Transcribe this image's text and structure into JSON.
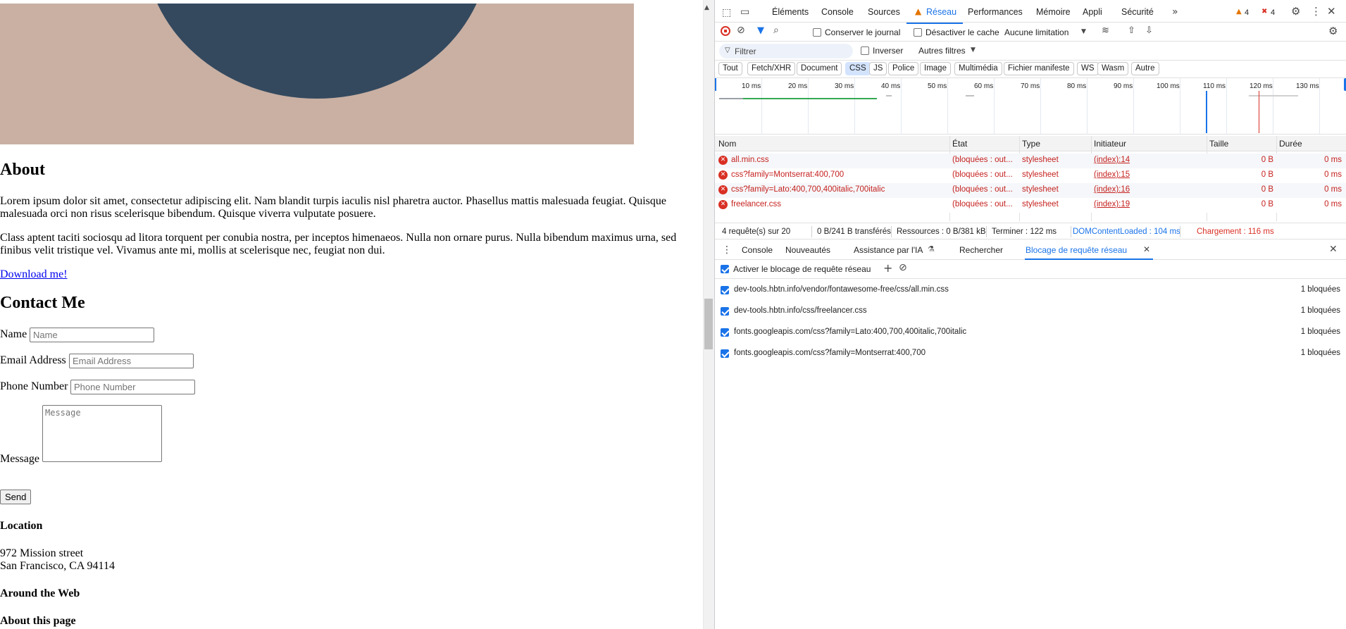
{
  "page": {
    "about_title": "About",
    "about_p1": "Lorem ipsum dolor sit amet, consectetur adipiscing elit. Nam blandit turpis iaculis nisl pharetra auctor. Phasellus mattis malesuada feugiat. Quisque malesuada orci non risus scelerisque bibendum. Quisque viverra vulputate posuere.",
    "about_p2": "Class aptent taciti sociosqu ad litora torquent per conubia nostra, per inceptos himenaeos. Nulla non ornare purus. Nulla bibendum maximus urna, sed finibus velit tristique vel. Vivamus ante mi, mollis at scelerisque nec, feugiat non dui.",
    "download_link": "Download me!",
    "contact_title": "Contact Me",
    "name_label": "Name",
    "name_placeholder": "Name",
    "email_label": "Email Address",
    "email_placeholder": "Email Address",
    "phone_label": "Phone Number",
    "phone_placeholder": "Phone Number",
    "message_label": "Message",
    "message_placeholder": "Message",
    "send_button": "Send",
    "location_title": "Location",
    "address_line1": "972 Mission street",
    "address_line2": "San Francisco, CA 94114",
    "around_web_title": "Around the Web",
    "about_page_title": "About this page",
    "colors": {
      "hero_bg": "#c9b0a3",
      "hero_circle": "#34495e",
      "hero_band": "#d9a741",
      "link": "#0000ee"
    }
  },
  "devtools": {
    "tabs": [
      "Éléments",
      "Console",
      "Sources",
      "Réseau",
      "Performances",
      "Mémoire",
      "Appli",
      "Sécurité"
    ],
    "active_tab": "Réseau",
    "more_tabs_icon": "chevron-double-right-icon",
    "warnings_count": "4",
    "errors_count": "4",
    "toolbar": {
      "preserve_log": "Conserver le journal",
      "disable_cache": "Désactiver le cache",
      "throttling": "Aucune limitation"
    },
    "filter": {
      "placeholder": "Filtrer",
      "invert": "Inverser",
      "more_filters": "Autres filtres"
    },
    "type_filters": [
      "Tout",
      "Fetch/XHR",
      "Document",
      "CSS",
      "JS",
      "Police",
      "Image",
      "Multimédia",
      "Fichier manifeste",
      "WS",
      "Wasm",
      "Autre"
    ],
    "active_type_filter": "CSS",
    "timeline_ticks": [
      "10 ms",
      "20 ms",
      "30 ms",
      "40 ms",
      "50 ms",
      "60 ms",
      "70 ms",
      "80 ms",
      "90 ms",
      "100 ms",
      "110 ms",
      "120 ms",
      "130 ms"
    ],
    "table": {
      "headers": [
        "Nom",
        "État",
        "Type",
        "Initiateur",
        "Taille",
        "Durée"
      ],
      "rows": [
        {
          "name": "all.min.css",
          "status": "(bloquées : out...",
          "type": "stylesheet",
          "initiator": "(index):14",
          "size": "0 B",
          "time": "0 ms"
        },
        {
          "name": "css?family=Montserrat:400,700",
          "status": "(bloquées : out...",
          "type": "stylesheet",
          "initiator": "(index):15",
          "size": "0 B",
          "time": "0 ms"
        },
        {
          "name": "css?family=Lato:400,700,400italic,700italic",
          "status": "(bloquées : out...",
          "type": "stylesheet",
          "initiator": "(index):16",
          "size": "0 B",
          "time": "0 ms"
        },
        {
          "name": "freelancer.css",
          "status": "(bloquées : out...",
          "type": "stylesheet",
          "initiator": "(index):19",
          "size": "0 B",
          "time": "0 ms"
        }
      ]
    },
    "summary": {
      "requests": "4 requête(s) sur 20",
      "transferred": "0 B/241 B transférés",
      "resources": "Ressources : 0 B/381 kB",
      "finish": "Terminer : 122 ms",
      "dcl": "DOMContentLoaded : 104 ms",
      "load": "Chargement : 116 ms"
    },
    "drawer": {
      "tabs": [
        "Console",
        "Nouveautés",
        "Assistance par l'IA",
        "Rechercher",
        "Blocage de requête réseau"
      ],
      "active_tab": "Blocage de requête réseau",
      "enable_blocking": "Activer le blocage de requête réseau",
      "patterns": [
        {
          "url": "dev-tools.hbtn.info/vendor/fontawesome-free/css/all.min.css",
          "count": "1 bloquées"
        },
        {
          "url": "dev-tools.hbtn.info/css/freelancer.css",
          "count": "1 bloquées"
        },
        {
          "url": "fonts.googleapis.com/css?family=Lato:400,700,400italic,700italic",
          "count": "1 bloquées"
        },
        {
          "url": "fonts.googleapis.com/css?family=Montserrat:400,700",
          "count": "1 bloquées"
        }
      ]
    },
    "colors": {
      "accent": "#1a73e8",
      "error": "#c5221f",
      "warning": "#e37400",
      "dcl_line": "#1a73e8",
      "load_line": "#d93025"
    }
  }
}
